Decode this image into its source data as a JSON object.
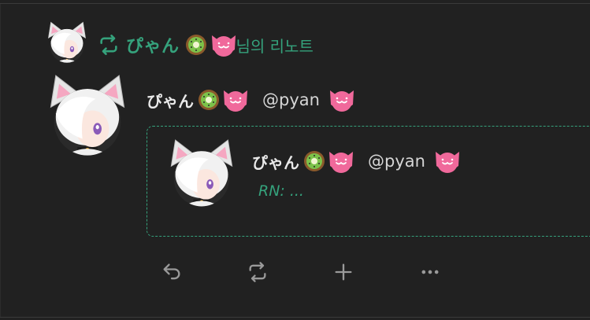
{
  "renote_header": {
    "user_name": "ぴゃん",
    "suffix": "님의 리노트",
    "renote_icon": "repeat-icon"
  },
  "note": {
    "user_name": "ぴゃん",
    "username": "@pyan",
    "emojis": [
      "kiwi-emoji",
      "pink-cat-emoji"
    ],
    "badge_emoji": "pink-cat-emoji"
  },
  "quoted_note": {
    "user_name": "ぴゃん",
    "username": "@pyan",
    "text": "RN: ..."
  },
  "actions": [
    {
      "name": "reply",
      "icon": "reply-icon"
    },
    {
      "name": "renote",
      "icon": "repeat-icon"
    },
    {
      "name": "react",
      "icon": "plus-icon"
    },
    {
      "name": "more",
      "icon": "more-dots-icon"
    }
  ],
  "colors": {
    "background": "#212121",
    "accent": "#35a27c",
    "text": "#e9e9e9",
    "icon_muted": "#9a9a9a",
    "emoji_pink": "#f0699b"
  }
}
